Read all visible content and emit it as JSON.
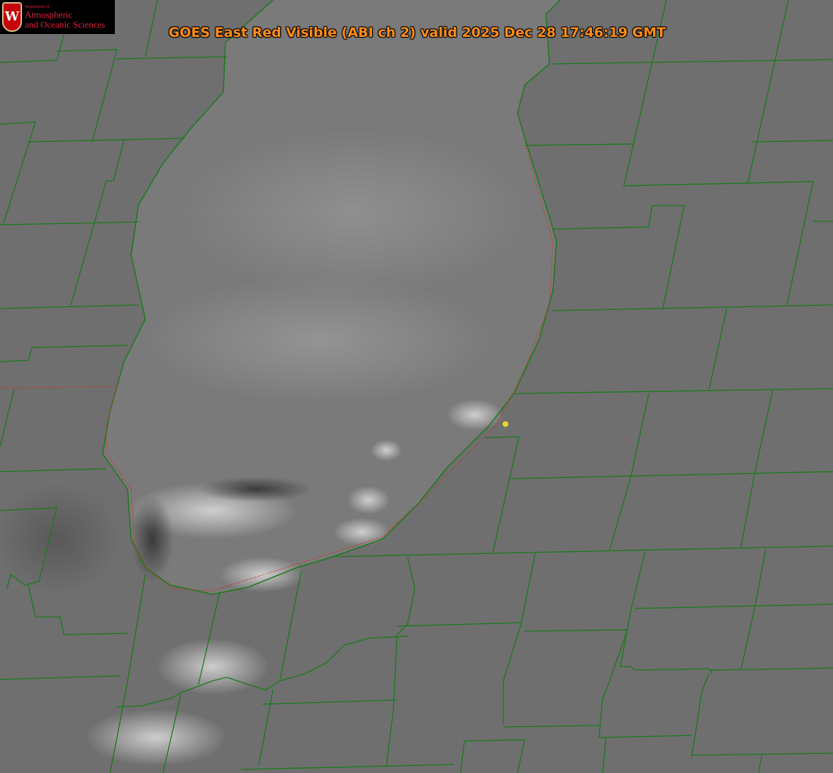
{
  "title": "GOES East Red Visible (ABI ch 2) valid 2025 Dec 28 17:46:19 GMT",
  "logo": {
    "dept": "Department of",
    "line1": "Atmospheric",
    "line2": "and Oceanic Sciences",
    "shield_letter": "W"
  },
  "colors": {
    "county_lines": "#1a7a1a",
    "shoreline_dotted": "#d03020",
    "title": "#ff8c1a",
    "marker": "#e8d820"
  }
}
